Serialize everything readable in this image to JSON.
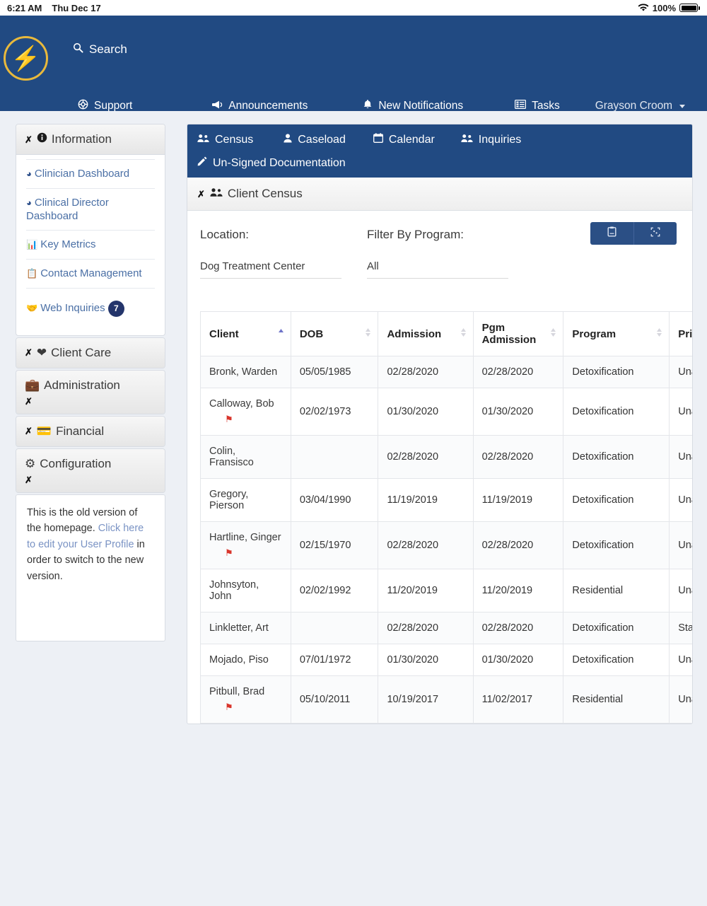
{
  "status_bar": {
    "time": "6:21 AM",
    "date": "Thu Dec 17",
    "battery_percent": "100%",
    "wifi_icon": "wifi-icon",
    "battery_icon": "battery-full-icon"
  },
  "topnav": {
    "logo_icon": "lightning-bolt-logo",
    "search_label": "Search",
    "search_icon": "search-icon",
    "items": [
      {
        "label": "Support",
        "icon": "life-ring-icon"
      },
      {
        "label": "Announcements",
        "icon": "bullhorn-icon"
      },
      {
        "label": "New Notifications",
        "icon": "bell-icon"
      },
      {
        "label": "Tasks",
        "icon": "tasks-icon"
      },
      {
        "label": "Grayson Croom",
        "icon": "caret-down-icon"
      }
    ]
  },
  "sidebar": {
    "sections": [
      {
        "title": "Information",
        "icon": "info-circle-icon",
        "chevron": "chevron-down-icon",
        "expanded": true,
        "links": [
          {
            "label": "Clinician Dashboard",
            "icon": "dashboard-icon"
          },
          {
            "label": "Clinical Director Dashboard",
            "icon": "dashboard-icon"
          },
          {
            "label": "Key Metrics",
            "icon": "chart-bar-icon"
          },
          {
            "label": "Contact Management",
            "icon": "id-card-icon"
          },
          {
            "label": "Web Inquiries",
            "icon": "handshake-icon",
            "badge": "7"
          }
        ]
      },
      {
        "title": "Client Care",
        "icon": "heart-icon",
        "chevron": "chevron-down-icon",
        "expanded": false
      },
      {
        "title": "Administration",
        "icon": "briefcase-icon",
        "chevron": "chevron-down-icon",
        "expanded": false
      },
      {
        "title": "Financial",
        "icon": "credit-card-icon",
        "chevron": "chevron-down-icon",
        "expanded": false
      },
      {
        "title": "Configuration",
        "icon": "cogs-icon",
        "chevron": "chevron-down-icon",
        "expanded": false
      }
    ],
    "note": {
      "text_before": "This is the old version of the homepage. ",
      "link_text": "Click here to edit your User Profile",
      "text_after": " in order to switch to the new version."
    }
  },
  "main": {
    "tabs_row1": [
      {
        "label": "Census",
        "icon": "users-icon"
      },
      {
        "label": "Caseload",
        "icon": "user-icon"
      },
      {
        "label": "Calendar",
        "icon": "calendar-icon"
      },
      {
        "label": "Inquiries",
        "icon": "users-icon"
      }
    ],
    "tabs_row2": [
      {
        "label": "Un-Signed Documentation",
        "icon": "pencil-icon"
      }
    ],
    "section_title": "Client Census",
    "section_icon": "users-icon",
    "section_chevron": "chevron-down-icon",
    "filters": {
      "location_label": "Location:",
      "location_value": "Dog Treatment Center",
      "program_label": "Filter By Program:",
      "program_value": "All",
      "buttons": [
        {
          "icon": "clipboard-icon",
          "name": "clipboard-button"
        },
        {
          "icon": "expand-columns-icon",
          "name": "column-settings-button"
        }
      ]
    },
    "table": {
      "columns": [
        {
          "label": "Client",
          "sort": "asc"
        },
        {
          "label": "DOB",
          "sort": "none"
        },
        {
          "label": "Admission",
          "sort": "none"
        },
        {
          "label": "Pgm Admission",
          "sort": "none"
        },
        {
          "label": "Program",
          "sort": "none"
        },
        {
          "label": "Pri Cou",
          "sort": "none"
        }
      ],
      "rows": [
        {
          "client": "Bronk, Warden",
          "flag": false,
          "dob": "05/05/1985",
          "admission": "02/28/2020",
          "pgm_admission": "02/28/2020",
          "program": "Detoxification",
          "pri_cou": "Unas"
        },
        {
          "client": "Calloway, Bob",
          "flag": true,
          "dob": "02/02/1973",
          "admission": "01/30/2020",
          "pgm_admission": "01/30/2020",
          "program": "Detoxification",
          "pri_cou": "Unas"
        },
        {
          "client": "Colin, Fransisco",
          "flag": false,
          "dob": "",
          "admission": "02/28/2020",
          "pgm_admission": "02/28/2020",
          "program": "Detoxification",
          "pri_cou": "Unas"
        },
        {
          "client": "Gregory, Pierson",
          "flag": false,
          "dob": "03/04/1990",
          "admission": "11/19/2019",
          "pgm_admission": "11/19/2019",
          "program": "Detoxification",
          "pri_cou": "Unas"
        },
        {
          "client": "Hartline, Ginger",
          "flag": true,
          "dob": "02/15/1970",
          "admission": "02/28/2020",
          "pgm_admission": "02/28/2020",
          "program": "Detoxification",
          "pri_cou": "Unas"
        },
        {
          "client": "Johnsyton, John",
          "flag": false,
          "dob": "02/02/1992",
          "admission": "11/20/2019",
          "pgm_admission": "11/20/2019",
          "program": "Residential",
          "pri_cou": "Unas"
        },
        {
          "client": "Linkletter, Art",
          "flag": false,
          "dob": "",
          "admission": "02/28/2020",
          "pgm_admission": "02/28/2020",
          "program": "Detoxification",
          "pri_cou": "Stag Teste"
        },
        {
          "client": "Mojado, Piso",
          "flag": false,
          "dob": "07/01/1972",
          "admission": "01/30/2020",
          "pgm_admission": "01/30/2020",
          "program": "Detoxification",
          "pri_cou": "Unas"
        },
        {
          "client": "Pitbull, Brad",
          "flag": true,
          "dob": "05/10/2011",
          "admission": "10/19/2017",
          "pgm_admission": "11/02/2017",
          "program": "Residential",
          "pri_cou": "Unas"
        }
      ]
    }
  },
  "colors": {
    "brand_blue": "#214a82",
    "logo_gold": "#f5b41d",
    "page_bg": "#edf0f5",
    "link_blue": "#4a6fa5",
    "flag_red": "#d9352c",
    "badge_navy": "#24356b"
  }
}
